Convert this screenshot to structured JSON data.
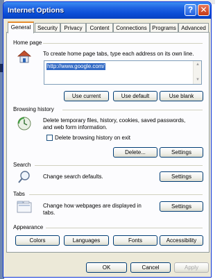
{
  "window": {
    "title": "Internet Options",
    "help_glyph": "?",
    "close_glyph": "✕"
  },
  "tabs": [
    "General",
    "Security",
    "Privacy",
    "Content",
    "Connections",
    "Programs",
    "Advanced"
  ],
  "home_page": {
    "label": "Home page",
    "description": "To create home page tabs, type each address on its own line.",
    "address": "http://www.google.com/",
    "use_current": "Use current",
    "use_default": "Use default",
    "use_blank": "Use blank"
  },
  "browsing_history": {
    "label": "Browsing history",
    "description_line1": "Delete temporary files, history, cookies, saved passwords,",
    "description_line2": "and web form information.",
    "delete_on_exit_label": "Delete browsing history on exit",
    "delete_on_exit_checked": false,
    "delete_button": "Delete...",
    "settings_button": "Settings"
  },
  "search": {
    "label": "Search",
    "description": "Change search defaults.",
    "settings_button": "Settings"
  },
  "tabs_section": {
    "label": "Tabs",
    "description_line1": "Change how webpages are displayed in",
    "description_line2": "tabs.",
    "settings_button": "Settings"
  },
  "appearance": {
    "label": "Appearance",
    "colors": "Colors",
    "languages": "Languages",
    "fonts": "Fonts",
    "accessibility": "Accessibility"
  },
  "footer": {
    "ok": "OK",
    "cancel": "Cancel",
    "apply": "Apply"
  }
}
